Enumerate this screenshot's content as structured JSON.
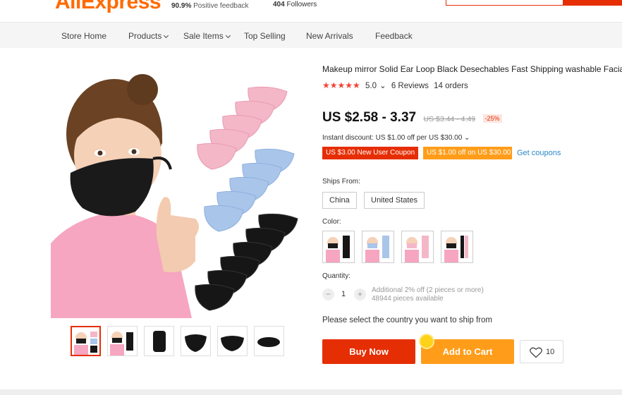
{
  "header": {
    "logo_text": "AliExpress",
    "positive_feedback_value": "90.9%",
    "positive_feedback_label": "Positive feedback",
    "followers_value": "404",
    "followers_label": "Followers"
  },
  "store_nav": [
    {
      "label": "Store Home",
      "has_dropdown": false
    },
    {
      "label": "Products",
      "has_dropdown": true
    },
    {
      "label": "Sale Items",
      "has_dropdown": true
    },
    {
      "label": "Top Selling",
      "has_dropdown": false
    },
    {
      "label": "New Arrivals",
      "has_dropdown": false
    },
    {
      "label": "Feedback",
      "has_dropdown": false
    }
  ],
  "product": {
    "title": "Makeup mirror Solid Ear Loop Black Desechables Fast Shipping washable Facial",
    "stars": "★★★★★",
    "rating": "5.0",
    "rating_caret": "⌄",
    "reviews": "6 Reviews",
    "orders": "14 orders",
    "price": "US $2.58 - 3.37",
    "old_price": "US $3.44 - 4.49",
    "discount": "-25%",
    "instant_discount": "Instant discount: US $1.00 off per US $30.00 ⌄",
    "coupons": [
      "US $3.00 New User Coupon",
      "US $1.00 off on US $30.00"
    ],
    "get_coupons": "Get coupons",
    "ships_from_label": "Ships From:",
    "ships_from_options": [
      "China",
      "United States"
    ],
    "color_label": "Color:",
    "quantity_label": "Quantity:",
    "quantity_minus": "−",
    "quantity_value": "1",
    "quantity_plus": "+",
    "additional_offer": "Additional 2% off (2 pieces or more)",
    "stock": "48944 pieces available",
    "ship_note": "Please select the country you want to ship from",
    "buy_now": "Buy Now",
    "add_to_cart": "Add to Cart",
    "wishlist_count": "10"
  },
  "colors": {
    "accent_red": "#e62e04",
    "accent_orange": "#ff9d1a",
    "star_red": "#f44336",
    "link_blue": "#2d88c7"
  }
}
